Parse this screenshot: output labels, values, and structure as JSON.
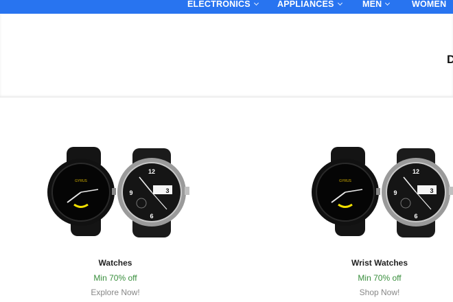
{
  "nav": {
    "items": [
      {
        "label": "ELECTRONICS",
        "has_dropdown": true
      },
      {
        "label": "APPLIANCES",
        "has_dropdown": true
      },
      {
        "label": "MEN",
        "has_dropdown": true
      },
      {
        "label": "WOMEN",
        "has_dropdown": false
      }
    ],
    "color": "#2874f0"
  },
  "banner": {
    "partial_heading": "D"
  },
  "products": [
    {
      "title": "Watches",
      "offer": "Min 70% off",
      "cta": "Explore Now!"
    },
    {
      "title": "Wrist Watches",
      "offer": "Min 70% off",
      "cta": "Shop Now!"
    }
  ],
  "colors": {
    "offer": "#388e3c",
    "cta": "#878787",
    "title": "#212121"
  },
  "icons": [
    "chevron-down-icon"
  ]
}
